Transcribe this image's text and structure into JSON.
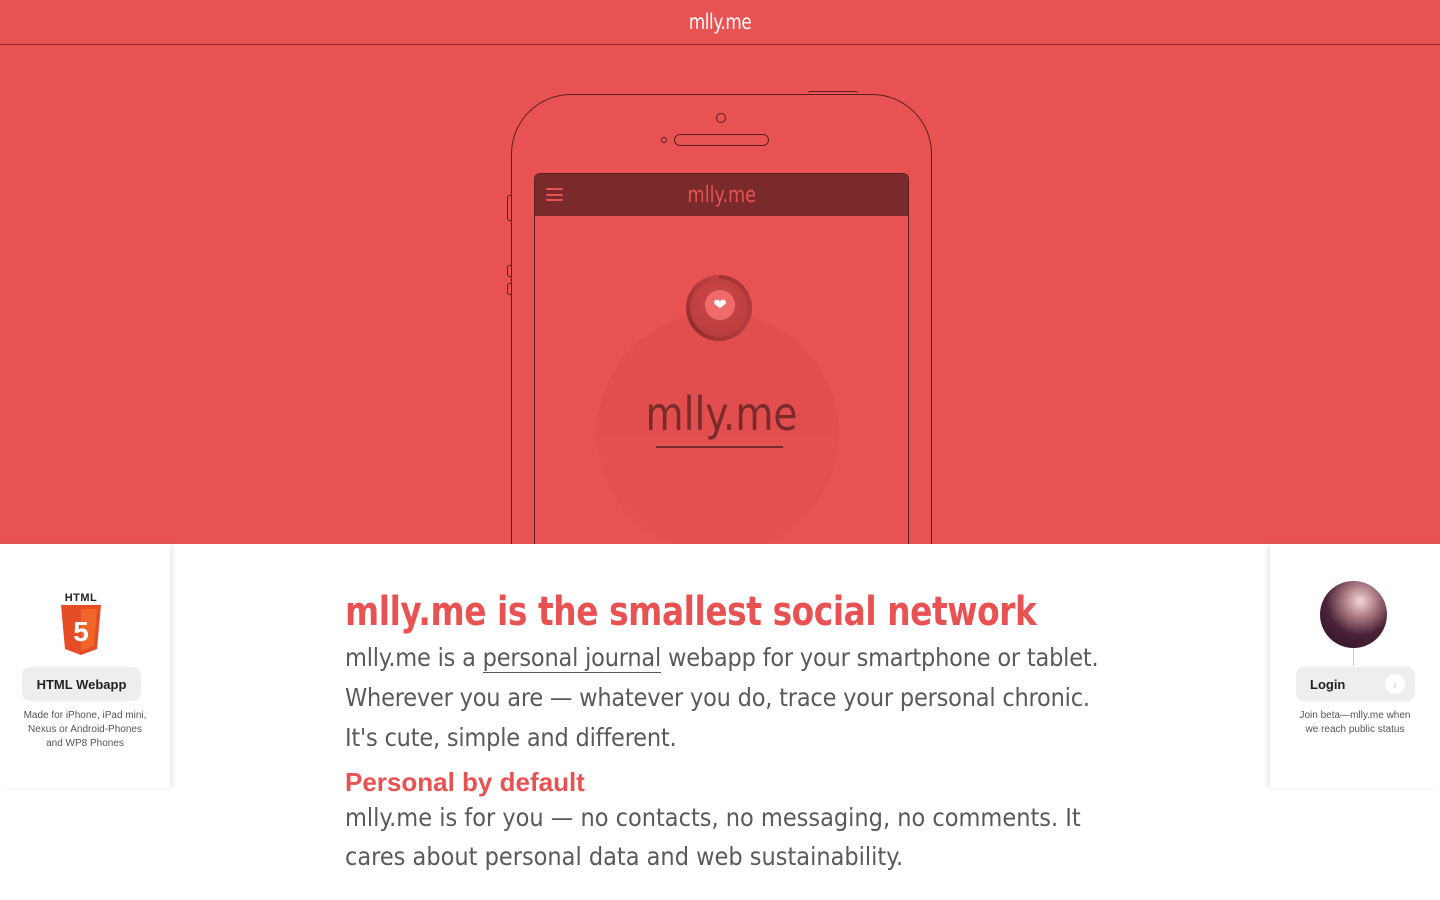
{
  "topbar": {
    "brand": "mlly.me"
  },
  "phone": {
    "app_title": "mlly.me",
    "wordmark": "mlly.me",
    "heart_icon": "heart-icon",
    "menu_icon": "menu-icon"
  },
  "left_panel": {
    "badge_word": "HTML",
    "badge_number": "5",
    "button_label": "HTML Webapp",
    "note": "Made for iPhone, iPad mini, Nexus or Android-Phones and WP8 Phones"
  },
  "right_panel": {
    "button_label": "Login",
    "arrow_icon": "chevron-right-icon",
    "note": "Join beta—mlly.me when we reach public status"
  },
  "main": {
    "heading": "mlly.me is the smallest social network",
    "intro_before": "mlly.me is a ",
    "intro_link": "personal journal",
    "intro_after": " webapp for your smartphone or tablet. Wherever you are — whatever you do, trace your personal chronic. It's cute, simple and different.",
    "subheading": "Personal by default",
    "paragraph": "mlly.me is for you — no contacts, no messaging, no comments. It cares about personal data and web sustainability."
  },
  "colors": {
    "brand": "#e85252",
    "dark": "#7a2a2a",
    "text": "#5a5a5a"
  }
}
